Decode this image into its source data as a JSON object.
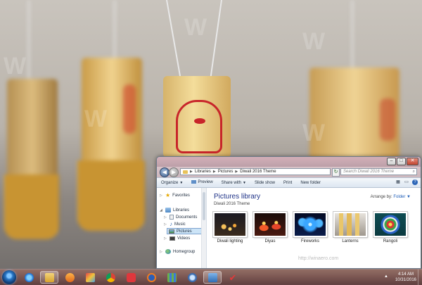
{
  "window": {
    "address": {
      "segments": [
        "Libraries",
        "Pictures",
        "Diwali 2016 Theme"
      ]
    },
    "search_placeholder": "Search Diwali 2016 Theme",
    "toolbar": {
      "organize": "Organize",
      "preview": "Preview",
      "share_with": "Share with",
      "slide_show": "Slide show",
      "print": "Print",
      "new_folder": "New folder"
    },
    "nav": {
      "favorites": "Favorites",
      "libraries": "Libraries",
      "documents": "Documents",
      "music": "Music",
      "pictures": "Pictures",
      "videos": "Videos",
      "homegroup": "Homegroup"
    },
    "content": {
      "title": "Pictures library",
      "subtitle": "Diwali 2016 Theme",
      "arrange_label": "Arrange by:",
      "arrange_value": "Folder",
      "items": [
        "Diwali lighting",
        "Diyas",
        "Fireworks",
        "Lanterns",
        "Rangoli"
      ],
      "watermark_url": "http://winaero.com"
    }
  },
  "wallpaper": {
    "watermark": "W"
  },
  "taskbar": {
    "time": "4:14 AM",
    "date": "10/31/2016",
    "apps": [
      "internet-explorer",
      "file-explorer",
      "media-player",
      "paint",
      "chrome",
      "vivaldi",
      "firefox",
      "app-grid",
      "magnifier",
      "remote-desktop",
      "check-app"
    ]
  },
  "colors": {
    "accent": "#1e3287",
    "taskbar": "#7a4c4a",
    "selection": "#cce4f7"
  }
}
